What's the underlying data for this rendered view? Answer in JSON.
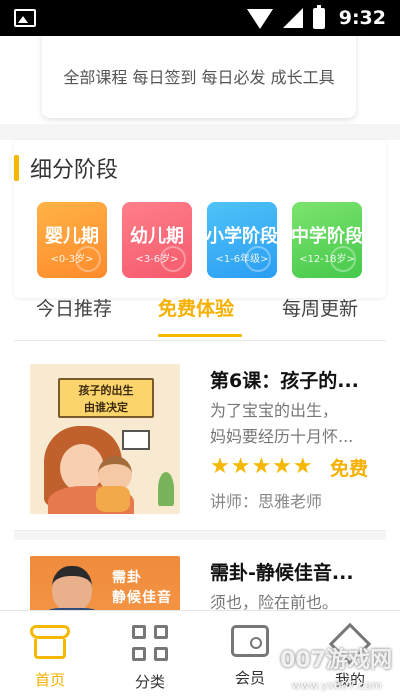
{
  "status_bar": {
    "time": "9:32"
  },
  "top_card": {
    "labels": "全部课程  每日签到  每日必发  成长工具"
  },
  "stages": {
    "title": "细分阶段",
    "items": [
      {
        "name": "婴儿期",
        "age": "<0-3岁>"
      },
      {
        "name": "幼儿期",
        "age": "<3-6岁>"
      },
      {
        "name": "小学阶段",
        "age": "<1-6年级>"
      },
      {
        "name": "中学阶段",
        "age": "<12-18岁>"
      }
    ]
  },
  "tabs": [
    {
      "label": "今日推荐",
      "active": false
    },
    {
      "label": "免费体验",
      "active": true
    },
    {
      "label": "每周更新",
      "active": false
    }
  ],
  "courses": [
    {
      "title": "第6课：孩子的...",
      "desc_line1": "为了宝宝的出生，",
      "desc_line2": "妈妈要经历十月怀...",
      "rating_stars": 5,
      "stars": "★★★★★",
      "price": "免费",
      "teacher": "讲师：思雅老师",
      "thumb_text": "孩子的出生\n由谁决定"
    },
    {
      "title": "需卦-静候佳音...",
      "desc_line1": "须也，险在前也。",
      "thumb_text": "需卦\n静候佳音"
    }
  ],
  "bottom_nav": [
    {
      "label": "首页",
      "icon": "shop-icon",
      "active": true
    },
    {
      "label": "分类",
      "icon": "grid-icon",
      "active": false
    },
    {
      "label": "会员",
      "icon": "wallet-icon",
      "active": false
    },
    {
      "label": "我的",
      "icon": "diamond-icon",
      "active": false
    }
  ],
  "watermark": {
    "main": "007游戏网",
    "sub": "www.yx007.com"
  },
  "colors": {
    "accent": "#f5b800",
    "stage_1": "#ff8a2b",
    "stage_2": "#f55a6b",
    "stage_3": "#2a9df4",
    "stage_4": "#45c94b"
  }
}
